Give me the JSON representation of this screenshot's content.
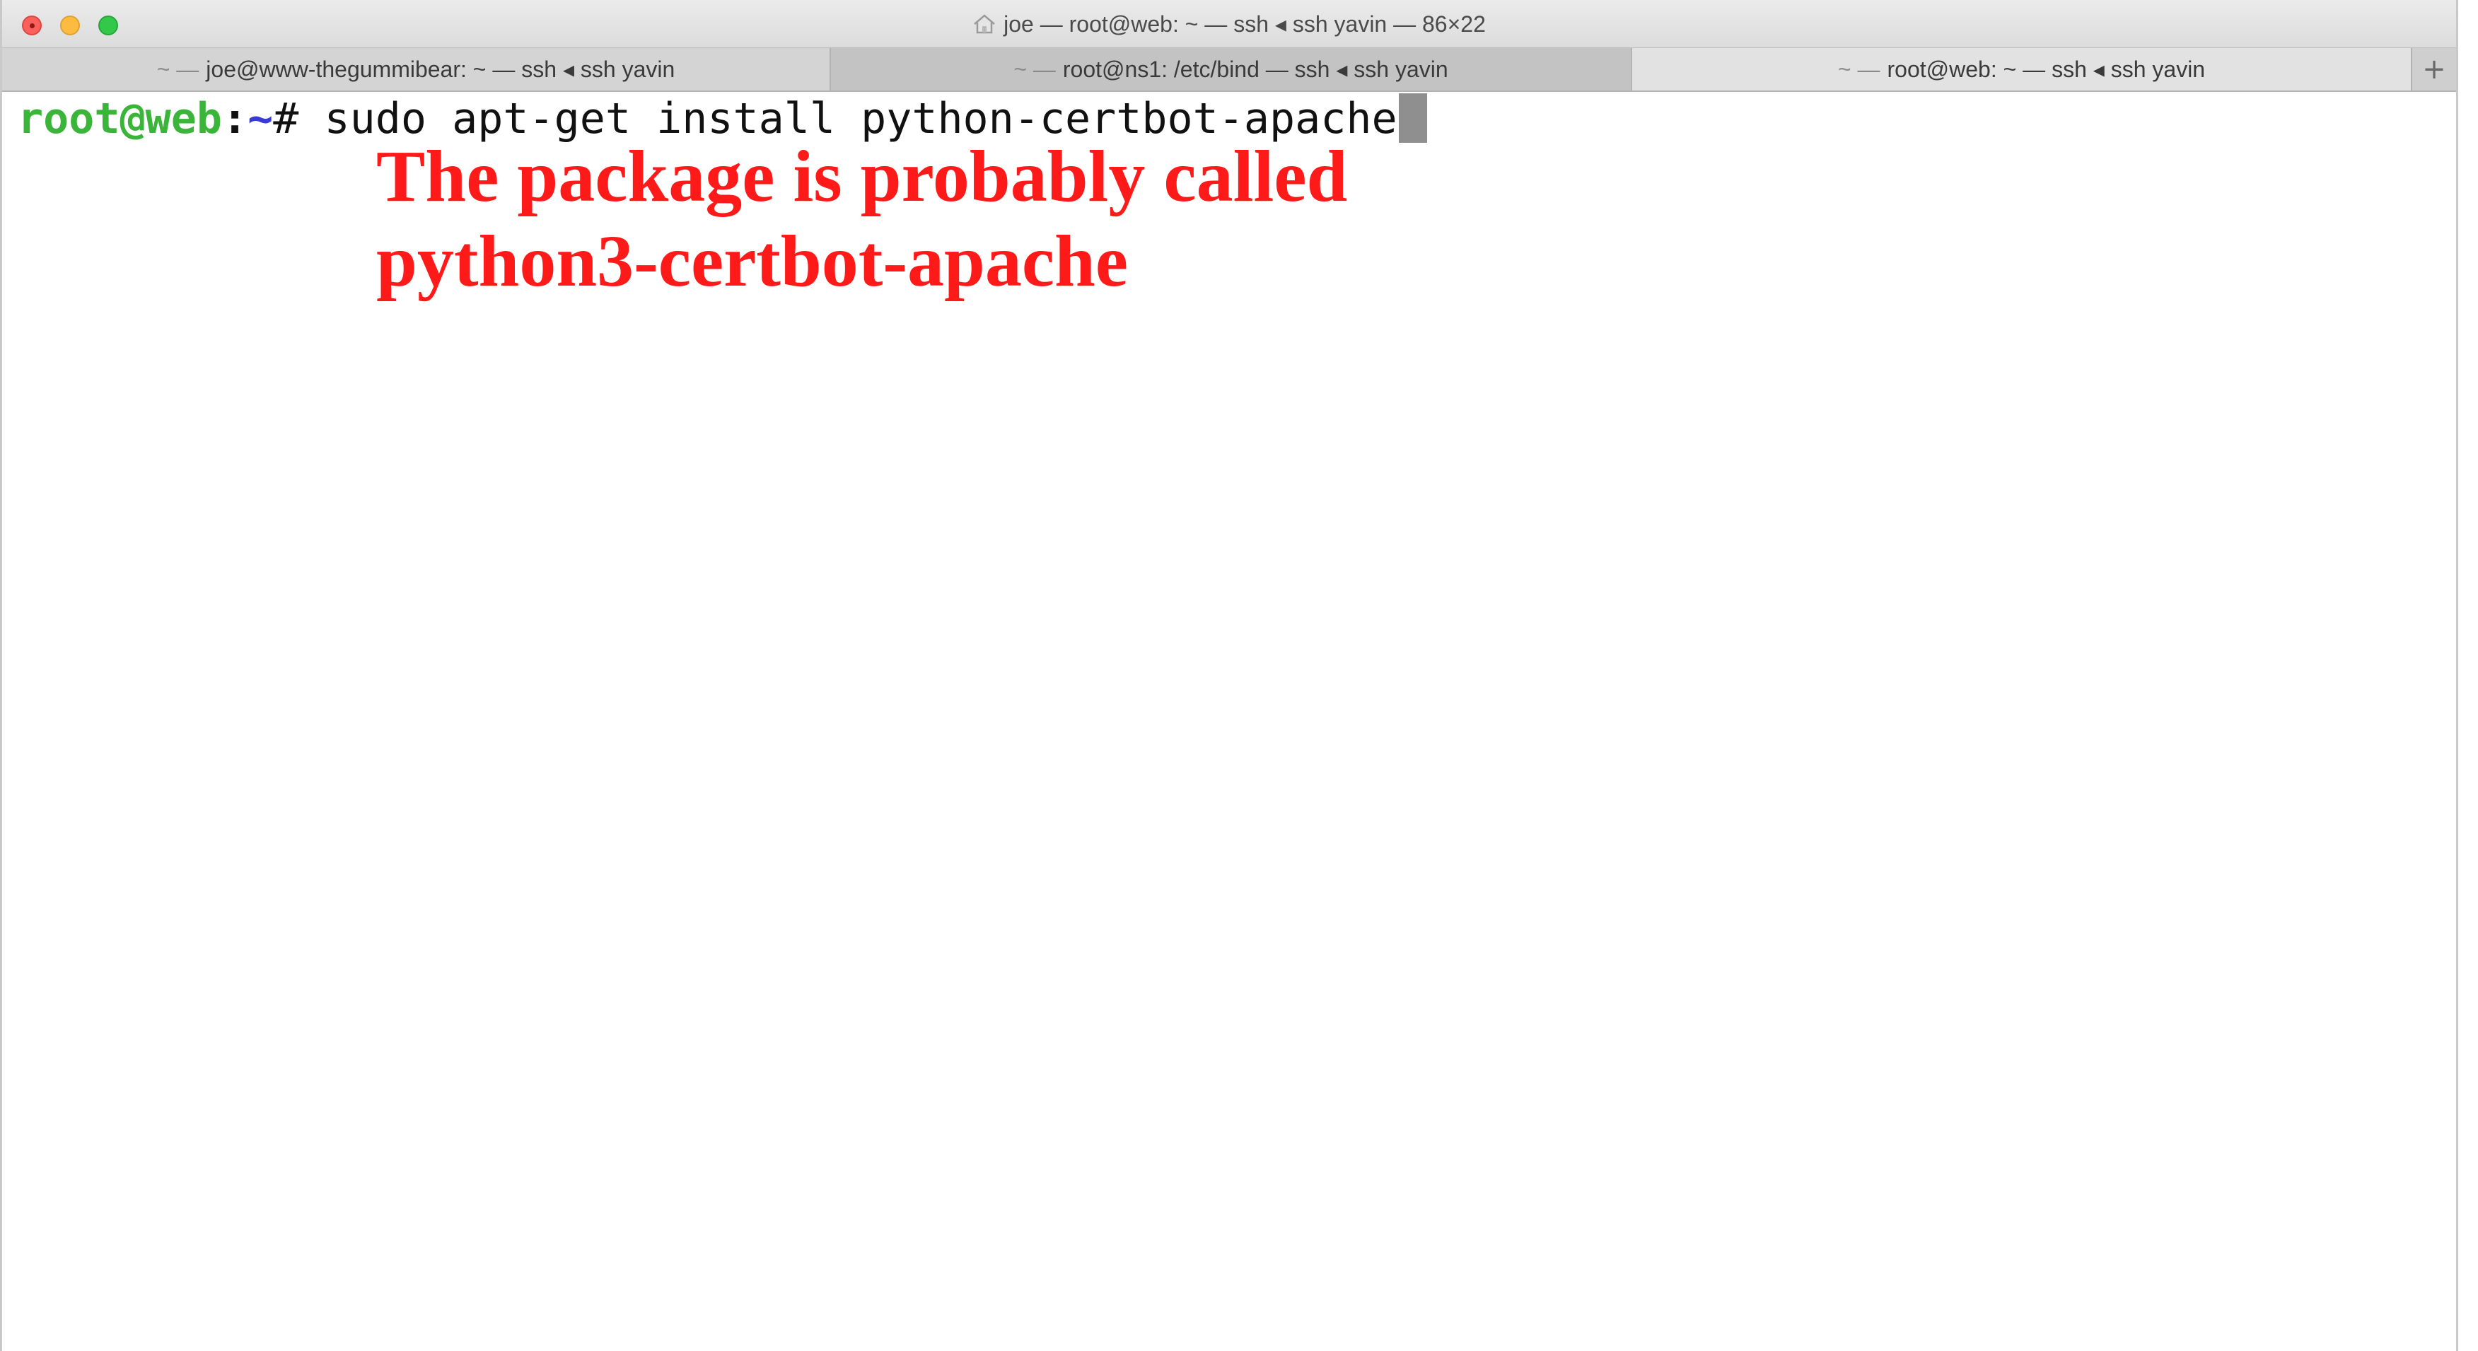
{
  "window": {
    "title": "joe — root@web: ~ — ssh ◂ ssh yavin — 86×22",
    "title_icon": "home-icon"
  },
  "tabs": [
    {
      "prefix": "~ —",
      "label": "joe@www-thegummibear: ~ — ssh ◂ ssh yavin"
    },
    {
      "prefix": "~ —",
      "label": "root@ns1: /etc/bind — ssh ◂ ssh yavin"
    },
    {
      "prefix": "~ —",
      "label": "root@web: ~ — ssh ◂ ssh yavin"
    }
  ],
  "new_tab_label": "+",
  "terminal": {
    "user_host": "root@web",
    "separator": ":",
    "path": "~",
    "prompt_char": "# ",
    "command": "sudo apt-get install python-certbot-apache"
  },
  "annotation": {
    "line1": "The package is probably called",
    "line2": "python3-certbot-apache"
  },
  "colors": {
    "prompt_user": "#3bb43a",
    "prompt_path": "#3a3ad8",
    "annotation": "#ff1a1a"
  }
}
